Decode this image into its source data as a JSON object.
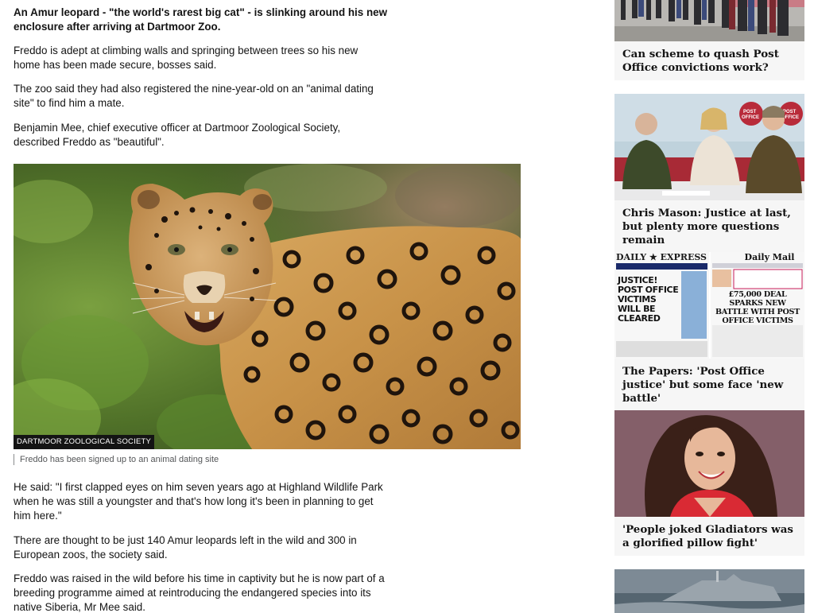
{
  "article": {
    "intro": "An Amur leopard - \"the world's rarest big cat\" - is slinking around his new enclosure after arriving at Dartmoor Zoo.",
    "paragraphs": [
      "Freddo is adept at climbing walls and springing between trees so his new home has been made secure, bosses said.",
      "The zoo said they had also registered the nine-year-old on an \"animal dating site\" to find him a mate.",
      "Benjamin Mee, chief executive officer at Dartmoor Zoological Society, described Freddo as \"beautiful\".",
      "He said: \"I first clapped eyes on him seven years ago at Highland Wildlife Park when he was still a youngster and that's how long it's been in planning to get him here.\"",
      "There are thought to be just 140 Amur leopards left in the wild and 300 in European zoos, the society said.",
      "Freddo was raised in the wild before his time in captivity but he is now part of a breeding programme aimed at reintroducing the endangered species into its native Siberia, Mr Mee said."
    ],
    "image": {
      "credit": "DARTMOOR ZOOLOGICAL SOCIETY",
      "caption": "Freddo has been signed up to an animal dating site"
    }
  },
  "sidebar": {
    "stories": [
      {
        "headline": "Can scheme to quash Post Office convictions work?"
      },
      {
        "headline": "Chris Mason: Justice at last, but plenty more questions remain"
      },
      {
        "headline": "The Papers: 'Post Office justice' but some face 'new battle'",
        "papers": {
          "left_masthead": "DAILY ★ EXPRESS",
          "left_headline": "JUSTICE! POST OFFICE VICTIMS WILL BE CLEARED",
          "right_masthead": "Daily Mail",
          "right_headline": "£75,000 DEAL SPARKS NEW BATTLE WITH POST OFFICE VICTIMS"
        }
      },
      {
        "headline": "'People joked Gladiators was a glorified pillow fight'"
      },
      {
        "headline": ""
      }
    ]
  }
}
